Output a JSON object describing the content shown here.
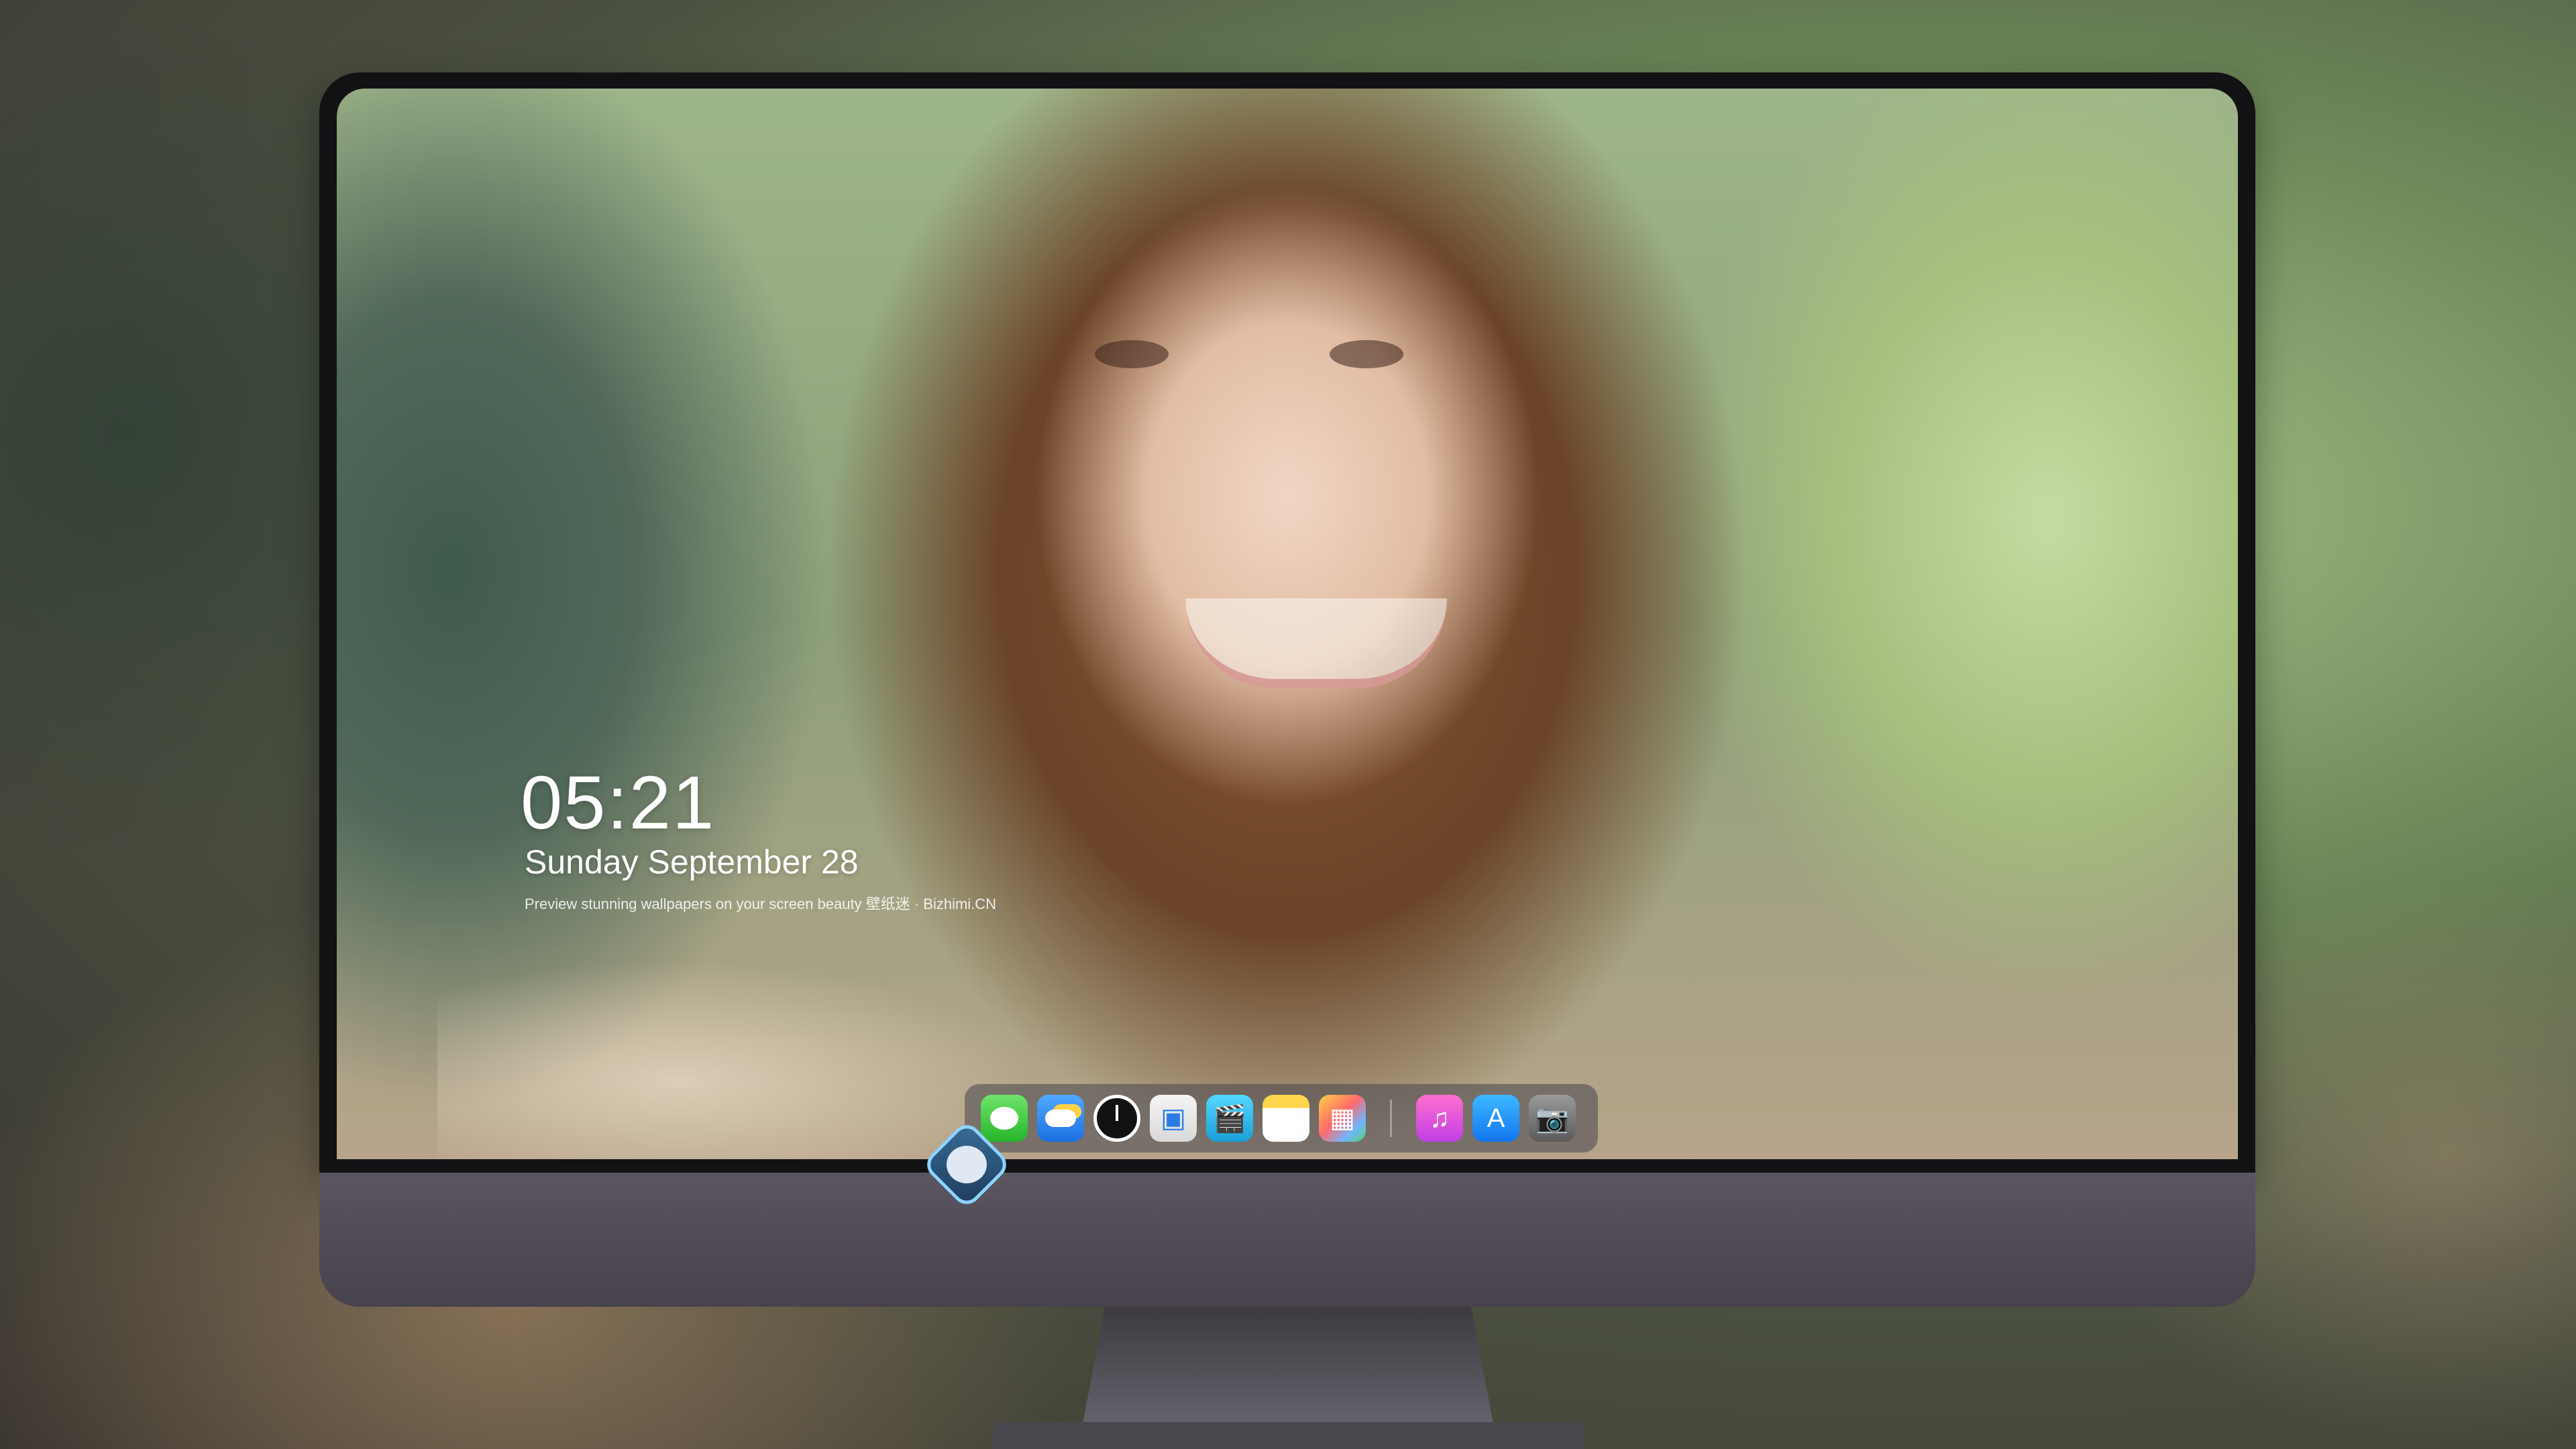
{
  "lock_screen": {
    "time": "05:21",
    "date": "Sunday September 28",
    "caption": "Preview stunning wallpapers on your screen beauty 壁纸迷 · Bizhimi.CN"
  },
  "dock": {
    "apps": [
      {
        "name": "Messages",
        "icon": "messages-icon"
      },
      {
        "name": "Weather",
        "icon": "weather-icon"
      },
      {
        "name": "Clock",
        "icon": "clock-icon"
      },
      {
        "name": "Preview",
        "icon": "preview-icon"
      },
      {
        "name": "Clips",
        "icon": "clips-icon"
      },
      {
        "name": "Notes",
        "icon": "notes-icon"
      },
      {
        "name": "Photos",
        "icon": "photos-icon"
      },
      {
        "name": "Music",
        "icon": "music-icon"
      },
      {
        "name": "App Store",
        "icon": "app-store-icon"
      },
      {
        "name": "Camera",
        "icon": "camera-icon"
      }
    ],
    "glyphs": {
      "clips": "🎬",
      "music": "♫",
      "appstore": "A",
      "camera": "📷",
      "preview": "▣",
      "photos": "▦"
    }
  },
  "brand": {
    "logo": "mascot-logo-icon"
  }
}
